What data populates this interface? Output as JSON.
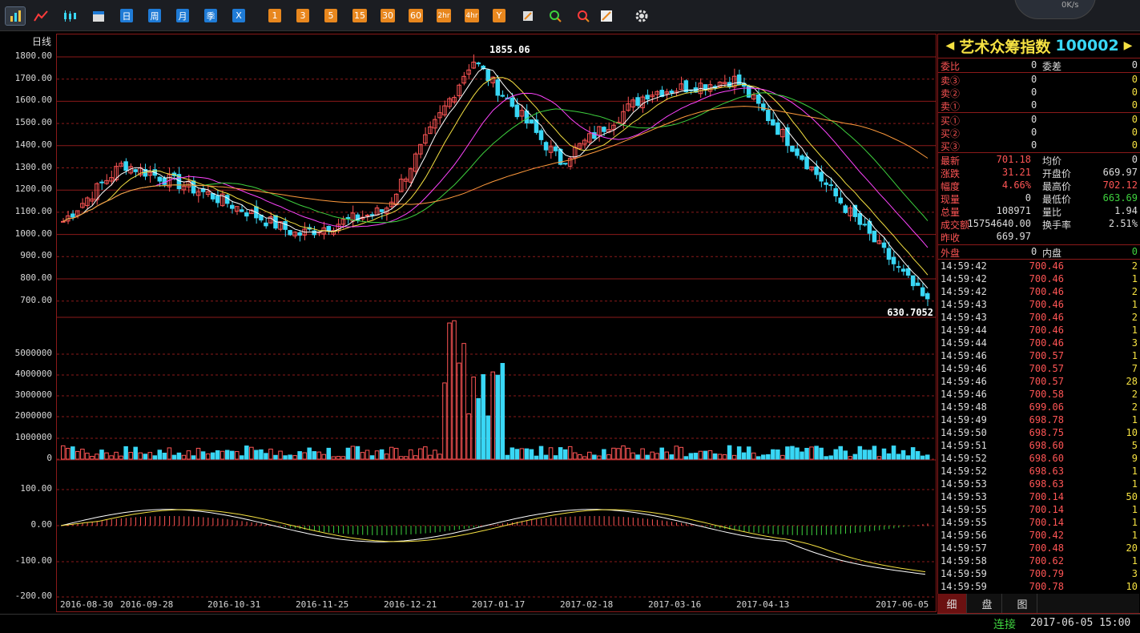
{
  "toolbar": {
    "periods": [
      "日",
      "周",
      "月",
      "季",
      "X"
    ],
    "minutes": [
      "1",
      "3",
      "5",
      "15",
      "30",
      "60",
      "2hr",
      "4hr",
      "Y"
    ],
    "speed": "0K/s"
  },
  "chart": {
    "period_label": "日线",
    "price_ticks": [
      "1800.00",
      "1700.00",
      "1600.00",
      "1500.00",
      "1400.00",
      "1300.00",
      "1200.00",
      "1100.00",
      "1000.00",
      "900.00",
      "800.00",
      "700.00"
    ],
    "volume_ticks": [
      "5000000",
      "4000000",
      "3000000",
      "2000000",
      "1000000",
      "0"
    ],
    "macd_ticks": [
      "100.00",
      "0.00",
      "-100.00",
      "-200.00"
    ],
    "date_labels": [
      "2016-08-30",
      "2016-09-28",
      "2016-10-31",
      "2016-11-25",
      "2016-12-21",
      "2017-01-17",
      "2017-02-18",
      "2017-03-16",
      "2017-04-13",
      "2017-06-05"
    ],
    "high_marker": "1855.06",
    "low_marker": "630.7052"
  },
  "chart_data": {
    "type": "line",
    "title": "",
    "xlabel": "",
    "ylabel": "",
    "x": [
      "2016-08-30",
      "2016-09-28",
      "2016-10-31",
      "2016-11-25",
      "2016-12-21",
      "2017-01-17",
      "2017-02-18",
      "2017-03-16",
      "2017-04-13",
      "2017-06-05"
    ],
    "series": [
      {
        "values": [
          1060,
          1320,
          1180,
          1000,
          1110,
          1790,
          1330,
          1640,
          1700,
          690
        ]
      }
    ],
    "ylim": [
      630,
      1860
    ],
    "grid": true
  },
  "side": {
    "title": "艺术众筹指数",
    "code": "100002",
    "order_ratio_label": "委比",
    "order_ratio": "0",
    "order_diff_label": "委差",
    "order_diff": "0",
    "asks": [
      {
        "label": "卖③",
        "price": "0",
        "vol": "0"
      },
      {
        "label": "卖②",
        "price": "0",
        "vol": "0"
      },
      {
        "label": "卖①",
        "price": "0",
        "vol": "0"
      }
    ],
    "bids": [
      {
        "label": "买①",
        "price": "0",
        "vol": "0"
      },
      {
        "label": "买②",
        "price": "0",
        "vol": "0"
      },
      {
        "label": "买③",
        "price": "0",
        "vol": "0"
      }
    ],
    "stats": [
      {
        "l1": "最新",
        "v1": "701.18",
        "l2": "均价",
        "v2": "0"
      },
      {
        "l1": "涨跌",
        "v1": "31.21",
        "l2": "开盘价",
        "v2": "669.97"
      },
      {
        "l1": "幅度",
        "v1": "4.66%",
        "l2": "最高价",
        "v2": "702.12"
      },
      {
        "l1": "现量",
        "v1": "0",
        "l2": "最低价",
        "v2": "663.69"
      },
      {
        "l1": "总量",
        "v1": "108971",
        "l2": "量比",
        "v2": "1.94"
      },
      {
        "l1": "成交额",
        "v1": "15754640.00",
        "l2": "换手率",
        "v2": "2.51%"
      },
      {
        "l1": "昨收",
        "v1": "669.97",
        "l2": "",
        "v2": ""
      }
    ],
    "outer_label": "外盘",
    "outer": "0",
    "inner_label": "内盘",
    "inner": "0",
    "ticks": [
      [
        "14:59:42",
        "700.46",
        "2"
      ],
      [
        "14:59:42",
        "700.46",
        "1"
      ],
      [
        "14:59:42",
        "700.46",
        "2"
      ],
      [
        "14:59:43",
        "700.46",
        "1"
      ],
      [
        "14:59:43",
        "700.46",
        "2"
      ],
      [
        "14:59:44",
        "700.46",
        "1"
      ],
      [
        "14:59:44",
        "700.46",
        "3"
      ],
      [
        "14:59:46",
        "700.57",
        "1"
      ],
      [
        "14:59:46",
        "700.57",
        "7"
      ],
      [
        "14:59:46",
        "700.57",
        "28"
      ],
      [
        "14:59:46",
        "700.58",
        "2"
      ],
      [
        "14:59:48",
        "699.06",
        "2"
      ],
      [
        "14:59:49",
        "698.78",
        "1"
      ],
      [
        "14:59:50",
        "698.75",
        "10"
      ],
      [
        "14:59:51",
        "698.60",
        "5"
      ],
      [
        "14:59:52",
        "698.60",
        "9"
      ],
      [
        "14:59:52",
        "698.63",
        "1"
      ],
      [
        "14:59:53",
        "698.63",
        "1"
      ],
      [
        "14:59:53",
        "700.14",
        "50"
      ],
      [
        "14:59:55",
        "700.14",
        "1"
      ],
      [
        "14:59:55",
        "700.14",
        "1"
      ],
      [
        "14:59:56",
        "700.42",
        "1"
      ],
      [
        "14:59:57",
        "700.48",
        "20"
      ],
      [
        "14:59:58",
        "700.62",
        "1"
      ],
      [
        "14:59:59",
        "700.79",
        "3"
      ],
      [
        "14:59:59",
        "700.78",
        "10"
      ]
    ],
    "tabs": [
      "细",
      "盘",
      "图"
    ]
  },
  "status": {
    "connection": "连接",
    "datetime": "2017-06-05 15:00"
  },
  "colors": {
    "up": "#ff5555",
    "down": "#39d7f5",
    "grid": "#8b1a1a"
  }
}
